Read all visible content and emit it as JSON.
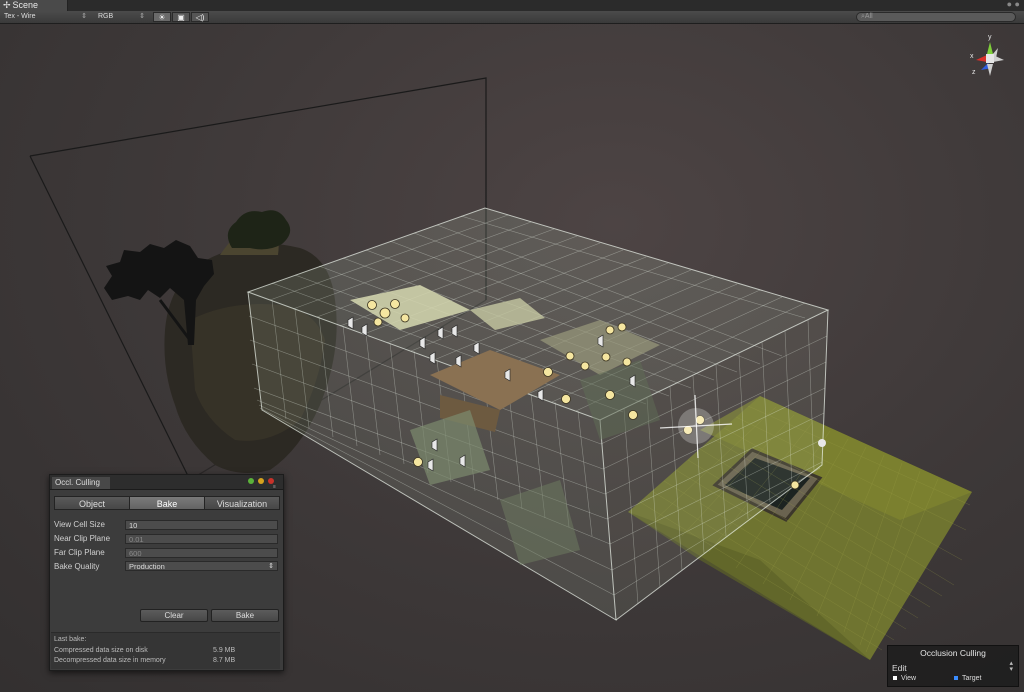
{
  "window": {
    "tab_label": "Scene",
    "tab_icon": "scene-crosshair-icon"
  },
  "toolbar": {
    "render_mode": "Tex - Wire",
    "color_mode": "RGB",
    "lighting_button_icon": "sun-icon",
    "image_button_icon": "image-icon",
    "audio_button_icon": "speaker-icon",
    "search_text": "All"
  },
  "occlusion_panel": {
    "title": "Occl. Culling",
    "tabs": [
      "Object",
      "Bake",
      "Visualization"
    ],
    "active_tab": "Bake",
    "fields": {
      "view_cell_size_label": "View Cell Size",
      "view_cell_size": "10",
      "near_clip_plane_label": "Near Clip Plane",
      "near_clip_plane": "0.01",
      "far_clip_plane_label": "Far Clip Plane",
      "far_clip_plane": "600",
      "bake_quality_label": "Bake Quality",
      "bake_quality": "Production"
    },
    "buttons": {
      "clear": "Clear",
      "bake": "Bake"
    },
    "info": {
      "header": "Last bake:",
      "disk_label": "Compressed data size on disk",
      "disk_value": "5.9 MB",
      "memory_label": "Decompressed data size in memory",
      "memory_value": "8.7 MB"
    }
  },
  "overlay": {
    "title": "Occlusion Culling",
    "mode": "Edit",
    "legend_view": "View",
    "legend_target": "Target",
    "view_color": "#ffffff",
    "target_color": "#3a8cff"
  },
  "gizmo": {
    "axes": [
      "x",
      "y",
      "z"
    ],
    "x_color": "#d8302a",
    "y_color": "#7fcf3a",
    "z_color": "#2f5de0"
  }
}
